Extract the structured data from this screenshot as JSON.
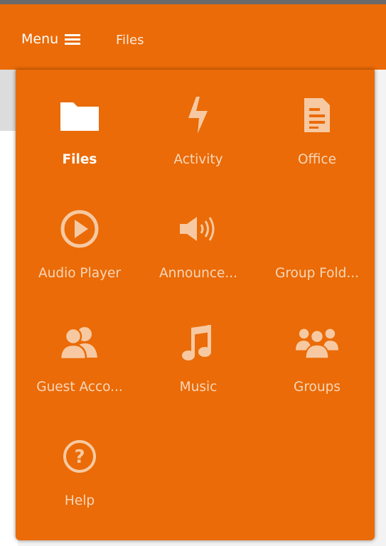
{
  "header": {
    "menu_label": "Menu",
    "current_app": "Files"
  },
  "apps": [
    {
      "label": "Files",
      "icon": "folder-icon",
      "active": true
    },
    {
      "label": "Activity",
      "icon": "lightning-icon"
    },
    {
      "label": "Office",
      "icon": "document-icon"
    },
    {
      "label": "Audio Player",
      "icon": "play-circle-icon"
    },
    {
      "label": "Announce...",
      "icon": "speaker-icon"
    },
    {
      "label": "Group Fold...",
      "icon": "group-folder-icon"
    },
    {
      "label": "Guest Acco...",
      "icon": "guests-icon"
    },
    {
      "label": "Music",
      "icon": "music-note-icon"
    },
    {
      "label": "Groups",
      "icon": "groups-icon"
    },
    {
      "label": "Help",
      "icon": "help-icon"
    }
  ],
  "colors": {
    "accent": "#ea6b07",
    "active_icon": "#ffffff",
    "inactive_icon": "#f7c9a2"
  }
}
